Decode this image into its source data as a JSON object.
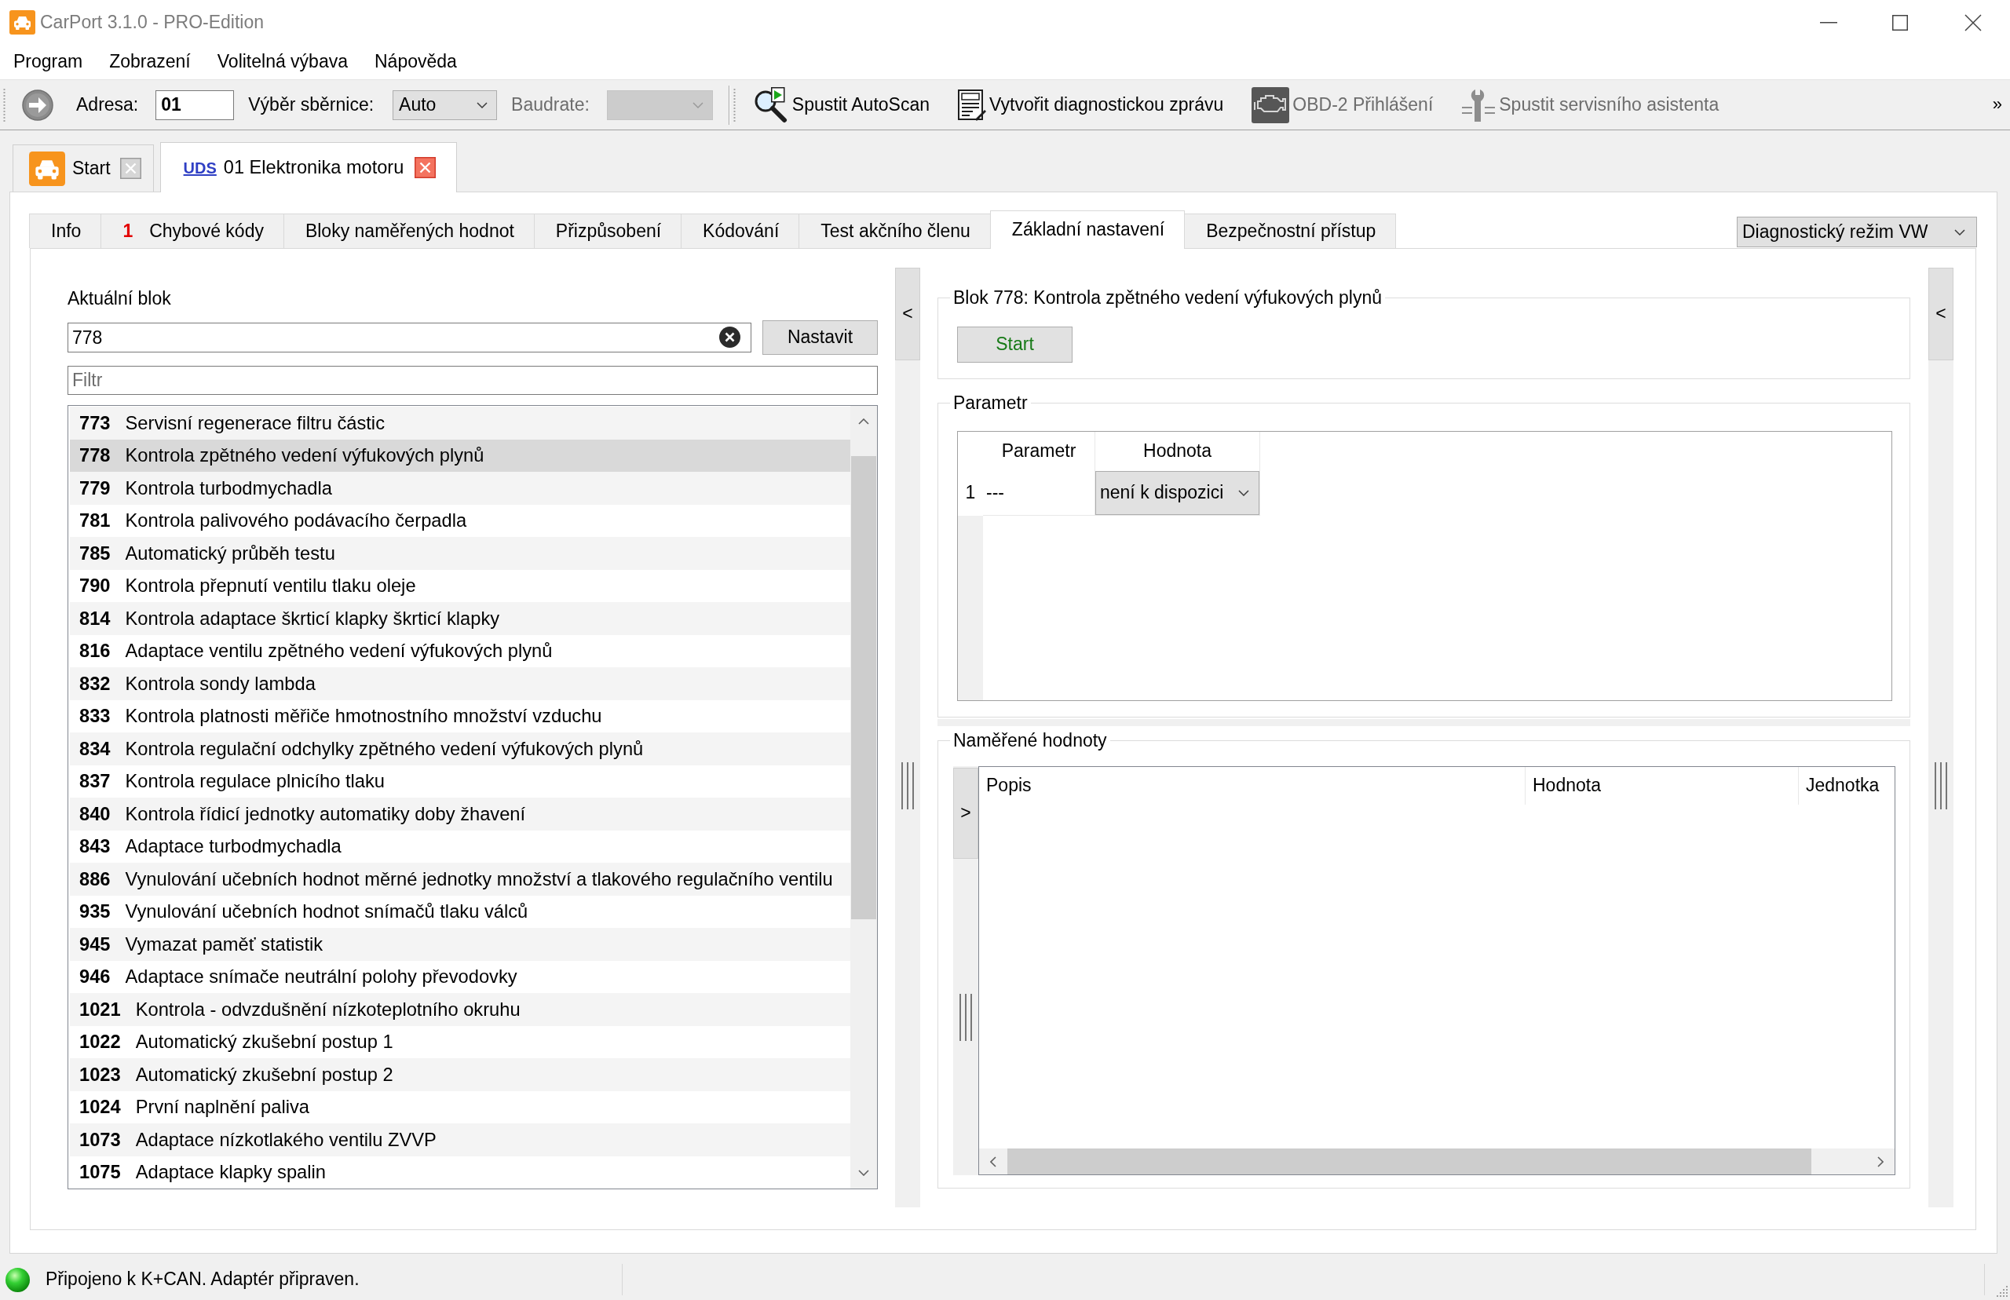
{
  "window": {
    "title": "CarPort 3.1.0 - PRO-Edition"
  },
  "menu": [
    "Program",
    "Zobrazení",
    "Volitelná výbava",
    "Nápověda"
  ],
  "toolbar": {
    "address": {
      "label": "Adresa:",
      "value": "01"
    },
    "bus": {
      "label": "Výběr sběrnice:",
      "value": "Auto"
    },
    "baudrate": {
      "label": "Baudrate:",
      "disabled": true
    },
    "actions": [
      {
        "kind": "autoscan",
        "label": "Spustit AutoScan",
        "disabled": false
      },
      {
        "kind": "report",
        "label": "Vytvořit diagnostickou zprávu",
        "disabled": false
      },
      {
        "kind": "engine",
        "label": "OBD-2 Přihlášení",
        "disabled": true
      },
      {
        "kind": "assistant",
        "label": "Spustit servisního asistenta",
        "disabled": true
      }
    ],
    "overflow": "»"
  },
  "document_tabs": [
    {
      "kind": "start",
      "label": "Start",
      "selected": false
    },
    {
      "kind": "module",
      "badge": "UDS",
      "label": "01 Elektronika motoru",
      "selected": true
    }
  ],
  "tabs": [
    {
      "label": "Info",
      "selected": false
    },
    {
      "count": "1",
      "label": "Chybové kódy",
      "selected": false
    },
    {
      "label": "Bloky naměřených hodnot",
      "selected": false
    },
    {
      "label": "Přizpůsobení",
      "selected": false
    },
    {
      "label": "Kódování",
      "selected": false
    },
    {
      "label": "Test akčního členu",
      "selected": false
    },
    {
      "label": "Základní nastavení",
      "selected": true
    },
    {
      "label": "Bezpečnostní přístup",
      "selected": false
    }
  ],
  "mode_select": {
    "value": "Diagnostický režim VW"
  },
  "block_panel": {
    "label": "Aktuální blok",
    "block_input": {
      "value": "778"
    },
    "set_button": "Nastavit",
    "filter": {
      "placeholder": "Filtr"
    },
    "blocks": [
      {
        "number": "773",
        "name": "Servisní regenerace filtru částic",
        "selected": false
      },
      {
        "number": "778",
        "name": "Kontrola zpětného vedení výfukových plynů",
        "selected": true
      },
      {
        "number": "779",
        "name": "Kontrola turbodmychadla",
        "selected": false
      },
      {
        "number": "781",
        "name": "Kontrola palivového podávacího čerpadla",
        "selected": false
      },
      {
        "number": "785",
        "name": "Automatický průběh testu",
        "selected": false
      },
      {
        "number": "790",
        "name": "Kontrola přepnutí ventilu tlaku oleje",
        "selected": false
      },
      {
        "number": "814",
        "name": "Kontrola adaptace škrticí klapky škrticí klapky",
        "selected": false
      },
      {
        "number": "816",
        "name": "Adaptace ventilu zpětného vedení výfukových plynů",
        "selected": false
      },
      {
        "number": "832",
        "name": "Kontrola sondy lambda",
        "selected": false
      },
      {
        "number": "833",
        "name": "Kontrola platnosti měřiče hmotnostního množství vzduchu",
        "selected": false
      },
      {
        "number": "834",
        "name": "Kontrola regulační odchylky zpětného vedení výfukových plynů",
        "selected": false
      },
      {
        "number": "837",
        "name": "Kontrola regulace plnicího tlaku",
        "selected": false
      },
      {
        "number": "840",
        "name": "Kontrola řídicí jednotky automatiky doby žhavení",
        "selected": false
      },
      {
        "number": "843",
        "name": "Adaptace turbodmychadla",
        "selected": false
      },
      {
        "number": "886",
        "name": "Vynulování učebních hodnot měrné jednotky množství a tlakového regulačního ventilu",
        "selected": false
      },
      {
        "number": "935",
        "name": "Vynulování učebních hodnot snímačů tlaku válců",
        "selected": false
      },
      {
        "number": "945",
        "name": "Vymazat paměť statistik",
        "selected": false
      },
      {
        "number": "946",
        "name": "Adaptace snímače neutrální polohy převodovky",
        "selected": false
      },
      {
        "number": "1021",
        "name": "Kontrola - odvzdušnění nízkoteplotního okruhu",
        "selected": false
      },
      {
        "number": "1022",
        "name": "Automatický zkušební postup 1",
        "selected": false
      },
      {
        "number": "1023",
        "name": "Automatický zkušební postup 2",
        "selected": false
      },
      {
        "number": "1024",
        "name": "První naplnění paliva",
        "selected": false
      },
      {
        "number": "1073",
        "name": "Adaptace nízkotlakého ventilu ZVVP",
        "selected": false
      },
      {
        "number": "1075",
        "name": "Adaptace klapky spalin",
        "selected": false
      }
    ]
  },
  "left_splitter": {
    "toggle": "<"
  },
  "basic_setting": {
    "title": "Blok 778: Kontrola zpětného vedení výfukových plynů",
    "start_button": "Start"
  },
  "parameters": {
    "title": "Parametr",
    "columns": [
      "Parametr",
      "Hodnota"
    ],
    "rows": [
      {
        "index": "1",
        "parameter": "---",
        "value": "není k dispozici"
      }
    ]
  },
  "measured_values": {
    "title": "Naměřené hodnoty",
    "toggle": ">",
    "columns": [
      "Popis",
      "Hodnota",
      "Jednotka"
    ]
  },
  "right_splitter": {
    "toggle": "<"
  },
  "status_bar": {
    "text": "Připojeno k K+CAN. Adaptér připraven.",
    "connected": true
  }
}
